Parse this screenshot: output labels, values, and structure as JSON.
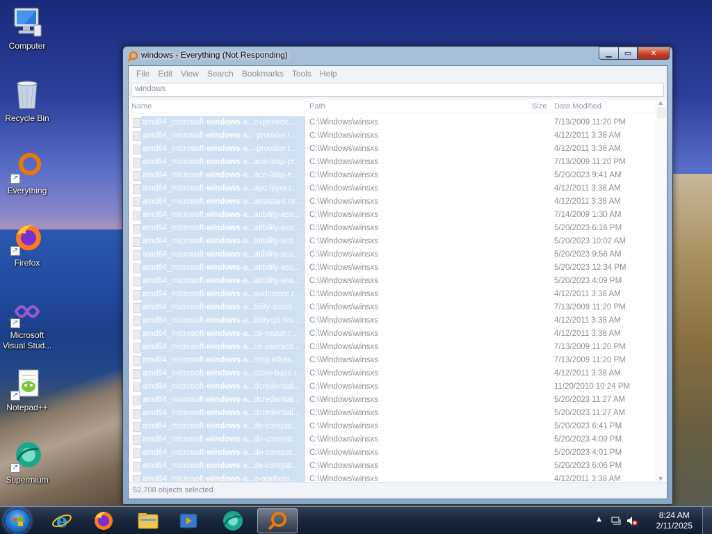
{
  "desktop_icons": [
    {
      "label": "Computer",
      "icon": "computer-icon"
    },
    {
      "label": "Recycle Bin",
      "icon": "recycle-bin-icon"
    },
    {
      "label": "Everything",
      "icon": "everything-icon"
    },
    {
      "label": "Firefox",
      "icon": "firefox-icon"
    },
    {
      "label": "Microsoft Visual Stud...",
      "icon": "visual-studio-icon"
    },
    {
      "label": "Notepad++",
      "icon": "notepadpp-icon"
    },
    {
      "label": "Supermium",
      "icon": "supermium-icon"
    }
  ],
  "window": {
    "title": "windows - Everything (Not Responding)",
    "menu": [
      "File",
      "Edit",
      "View",
      "Search",
      "Bookmarks",
      "Tools",
      "Help"
    ],
    "search_value": "windows",
    "columns": {
      "name": "Name",
      "path": "Path",
      "size": "Size",
      "date": "Date Modified"
    },
    "rows": [
      {
        "pre": "amd64_microsoft-",
        "hl": "windows",
        "post": "-a...experienc...",
        "path": "C:\\Windows\\winsxs",
        "date": "7/13/2009 11:20 PM"
      },
      {
        "pre": "amd64_microsoft-",
        "hl": "windows",
        "post": "-a...-provider.r...",
        "path": "C:\\Windows\\winsxs",
        "date": "4/12/2011 3:38 AM"
      },
      {
        "pre": "amd64_microsoft-",
        "hl": "windows",
        "post": "-a...-provider.r...",
        "path": "C:\\Windows\\winsxs",
        "date": "4/12/2011 3:38 AM"
      },
      {
        "pre": "amd64_microsoft-",
        "hl": "windows",
        "post": "-a...ace-ldap-pr...",
        "path": "C:\\Windows\\winsxs",
        "date": "7/13/2009 11:20 PM"
      },
      {
        "pre": "amd64_microsoft-",
        "hl": "windows",
        "post": "-a...ace-ldap-e...",
        "path": "C:\\Windows\\winsxs",
        "date": "5/20/2023 9:41 AM"
      },
      {
        "pre": "amd64_microsoft-",
        "hl": "windows",
        "post": "-a...apc-layer.r...",
        "path": "C:\\Windows\\winsxs",
        "date": "4/12/2011 3:38 AM"
      },
      {
        "pre": "amd64_microsoft-",
        "hl": "windows",
        "post": "-a...assistant.re...",
        "path": "C:\\Windows\\winsxs",
        "date": "4/12/2011 3:38 AM"
      },
      {
        "pre": "amd64_microsoft-",
        "hl": "windows",
        "post": "-a...atibility-ass...",
        "path": "C:\\Windows\\winsxs",
        "date": "7/14/2009 1:30 AM"
      },
      {
        "pre": "amd64_microsoft-",
        "hl": "windows",
        "post": "-a...atibility-ass...",
        "path": "C:\\Windows\\winsxs",
        "date": "5/20/2023 6:16 PM"
      },
      {
        "pre": "amd64_microsoft-",
        "hl": "windows",
        "post": "-a...atibility-ass...",
        "path": "C:\\Windows\\winsxs",
        "date": "5/20/2023 10:02 AM"
      },
      {
        "pre": "amd64_microsoft-",
        "hl": "windows",
        "post": "-a...atibility-ass...",
        "path": "C:\\Windows\\winsxs",
        "date": "5/20/2023 9:56 AM"
      },
      {
        "pre": "amd64_microsoft-",
        "hl": "windows",
        "post": "-a...atibility-ass...",
        "path": "C:\\Windows\\winsxs",
        "date": "5/20/2023 12:34 PM"
      },
      {
        "pre": "amd64_microsoft-",
        "hl": "windows",
        "post": "-a...atibility-ass...",
        "path": "C:\\Windows\\winsxs",
        "date": "5/20/2023 4:09 PM"
      },
      {
        "pre": "amd64_microsoft-",
        "hl": "windows",
        "post": "-a...audiocore.r...",
        "path": "C:\\Windows\\winsxs",
        "date": "4/12/2011 3:38 AM"
      },
      {
        "pre": "amd64_microsoft-",
        "hl": "windows",
        "post": "-a...bility-asset...",
        "path": "C:\\Windows\\winsxs",
        "date": "7/13/2009 11:20 PM"
      },
      {
        "pre": "amd64_microsoft-",
        "hl": "windows",
        "post": "-a...bilitycpl.res...",
        "path": "C:\\Windows\\winsxs",
        "date": "4/12/2011 3:38 AM"
      },
      {
        "pre": "amd64_microsoft-",
        "hl": "windows",
        "post": "-a...ce-router.r...",
        "path": "C:\\Windows\\winsxs",
        "date": "4/12/2011 3:38 AM"
      },
      {
        "pre": "amd64_microsoft-",
        "hl": "windows",
        "post": "-a...ce-useracti...",
        "path": "C:\\Windows\\winsxs",
        "date": "7/13/2009 11:20 PM"
      },
      {
        "pre": "amd64_microsoft-",
        "hl": "windows",
        "post": "-a...cing-infras...",
        "path": "C:\\Windows\\winsxs",
        "date": "7/13/2009 11:20 PM"
      },
      {
        "pre": "amd64_microsoft-",
        "hl": "windows",
        "post": "-a...ctore-base.r...",
        "path": "C:\\Windows\\winsxs",
        "date": "4/12/2011 3:38 AM"
      },
      {
        "pre": "amd64_microsoft-",
        "hl": "windows",
        "post": "-a...dcredential...",
        "path": "C:\\Windows\\winsxs",
        "date": "11/20/2010 10:24 PM"
      },
      {
        "pre": "amd64_microsoft-",
        "hl": "windows",
        "post": "-a...dcredential...",
        "path": "C:\\Windows\\winsxs",
        "date": "5/20/2023 11:27 AM"
      },
      {
        "pre": "amd64_microsoft-",
        "hl": "windows",
        "post": "-a...dcredential...",
        "path": "C:\\Windows\\winsxs",
        "date": "5/20/2023 11:27 AM"
      },
      {
        "pre": "amd64_microsoft-",
        "hl": "windows",
        "post": "-a...de-compat...",
        "path": "C:\\Windows\\winsxs",
        "date": "5/20/2023 6:41 PM"
      },
      {
        "pre": "amd64_microsoft-",
        "hl": "windows",
        "post": "-a...de-compat...",
        "path": "C:\\Windows\\winsxs",
        "date": "5/20/2023 4:09 PM"
      },
      {
        "pre": "amd64_microsoft-",
        "hl": "windows",
        "post": "-a...de-compat...",
        "path": "C:\\Windows\\winsxs",
        "date": "5/20/2023 4:01 PM"
      },
      {
        "pre": "amd64_microsoft-",
        "hl": "windows",
        "post": "-a...de-compat...",
        "path": "C:\\Windows\\winsxs",
        "date": "5/20/2023 6:06 PM"
      },
      {
        "pre": "amd64_microsoft-",
        "hl": "windows",
        "post": "-a...e-apphelp...",
        "path": "C:\\Windows\\winsxs",
        "date": "4/12/2011 3:38 AM"
      }
    ],
    "status": "52,708 objects selected"
  },
  "taskbar": {
    "apps": [
      "internet-explorer-icon",
      "firefox-icon",
      "file-explorer-icon",
      "media-player-icon",
      "supermium-icon",
      "everything-icon"
    ],
    "time": "8:24 AM",
    "date": "2/11/2025"
  },
  "colors": {
    "selection": "#cfe0f3",
    "everything_orange": "#f07800"
  }
}
